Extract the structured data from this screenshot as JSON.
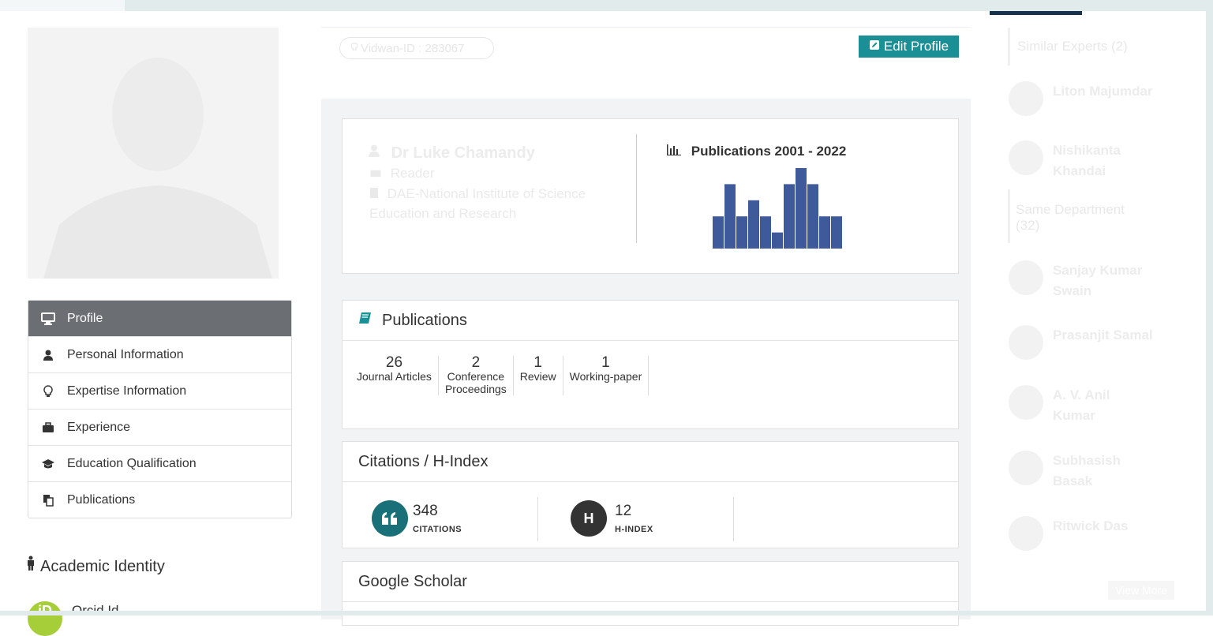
{
  "colors": {
    "accent": "#1a9096",
    "menu_active": "#6b6e73",
    "chart_bar": "#3f5a9b",
    "orcid": "#a6ce39",
    "h_badge": "#333333"
  },
  "profile": {
    "vidwan_id": "Vidwan-ID : 283067",
    "edit_button": "Edit Profile",
    "name": "Dr Luke Chamandy",
    "designation": "Reader",
    "institute_line1": "DAE-National Institute of Science",
    "institute_line2": "Education and Research"
  },
  "menu": {
    "items": [
      {
        "label": "Profile",
        "icon": "desktop-icon"
      },
      {
        "label": "Personal Information",
        "icon": "user-icon"
      },
      {
        "label": "Expertise Information",
        "icon": "lightbulb-icon"
      },
      {
        "label": "Experience",
        "icon": "briefcase-icon"
      },
      {
        "label": "Education Qualification",
        "icon": "graduation-cap-icon"
      },
      {
        "label": "Publications",
        "icon": "copy-icon"
      }
    ]
  },
  "academic_identity": {
    "title": "Academic Identity",
    "orcid_label": "Orcid Id",
    "orcid_icon": "iD"
  },
  "publications_chart": {
    "title": "Publications 2001 - 2022"
  },
  "chart_data": {
    "type": "bar",
    "values": [
      2,
      4,
      2,
      3,
      2,
      1,
      4,
      5,
      4,
      2,
      2
    ],
    "ylim": [
      0,
      5
    ],
    "color": "#3f5a9b"
  },
  "publications": {
    "title": "Publications",
    "stats": [
      {
        "count": "26",
        "label1": "Journal Articles",
        "label2": ""
      },
      {
        "count": "2",
        "label1": "Conference",
        "label2": "Proceedings"
      },
      {
        "count": "1",
        "label1": "Review",
        "label2": ""
      },
      {
        "count": "1",
        "label1": "Working-paper",
        "label2": ""
      }
    ]
  },
  "citations": {
    "title": "Citations / H-Index",
    "citations_value": "348",
    "citations_label": "CITATIONS",
    "hindex_value": "12",
    "hindex_label": "H-INDEX",
    "hindex_badge": "H"
  },
  "google_scholar": {
    "title": "Google Scholar"
  },
  "sidebar": {
    "similar_title": "Similar Experts (2)",
    "department_title_1": "Same Department",
    "department_title_2": "(32)",
    "view_more": "View More",
    "similar": [
      {
        "line1": "Liton Majumdar",
        "line2": ""
      },
      {
        "line1": "Nishikanta",
        "line2": "Khandai"
      }
    ],
    "department": [
      {
        "line1": "Sanjay Kumar",
        "line2": "Swain"
      },
      {
        "line1": "Prasanjit Samal",
        "line2": ""
      },
      {
        "line1": "A. V. Anil",
        "line2": "Kumar"
      },
      {
        "line1": "Subhasish",
        "line2": "Basak"
      },
      {
        "line1": "Ritwick Das",
        "line2": ""
      }
    ]
  }
}
